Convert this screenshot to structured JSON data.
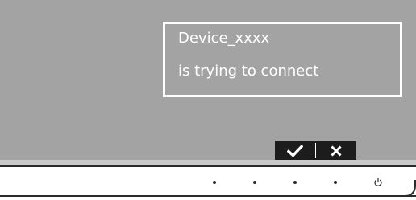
{
  "notification": {
    "device_name": "Device_xxxx",
    "message": "is trying to connect"
  },
  "osd": {
    "accept_icon": "checkmark-icon",
    "reject_icon": "close-icon"
  },
  "hardware_buttons": {
    "icons": [
      "dot-icon",
      "dot-icon",
      "dot-icon",
      "dot-icon",
      "power-icon"
    ]
  },
  "colors": {
    "screen": "#a3a3a3",
    "text": "#ffffff",
    "osd_bar": "#1c1c1c",
    "bezel": "#2a2a2a"
  }
}
